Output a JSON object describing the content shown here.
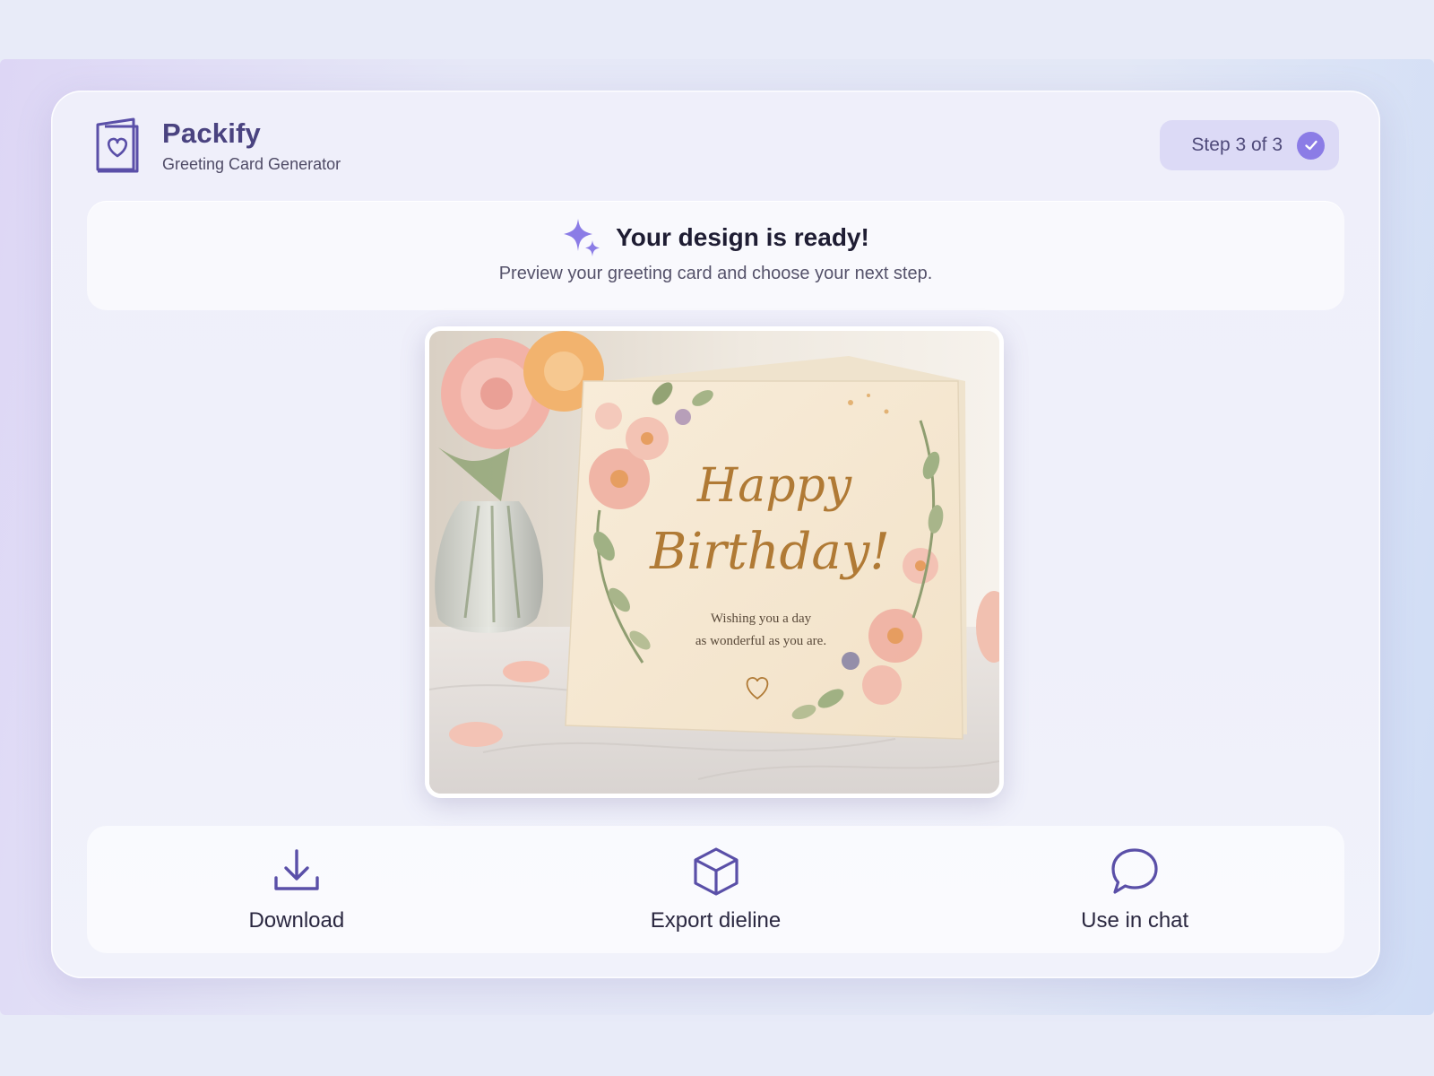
{
  "app": {
    "name": "Packify",
    "subtitle": "Greeting Card Generator",
    "logo_icon": "card-heart-icon"
  },
  "step": {
    "label": "Step 3 of 3",
    "icon": "check-circle-icon"
  },
  "status": {
    "title": "Your design is ready!",
    "subtitle": "Preview your greeting card and choose your next step.",
    "icon": "sparkle-icon"
  },
  "preview": {
    "headline_line1": "Happy",
    "headline_line2": "Birthday!",
    "message_line1": "Wishing you a day",
    "message_line2": "as wonderful as you are."
  },
  "actions": [
    {
      "label": "Download",
      "icon": "download-icon"
    },
    {
      "label": "Export dieline",
      "icon": "box-icon"
    },
    {
      "label": "Use in chat",
      "icon": "chat-bubble-icon"
    }
  ],
  "colors": {
    "accent": "#8b7ce6",
    "brand": "#4a4380",
    "icon": "#5a4fa8"
  }
}
